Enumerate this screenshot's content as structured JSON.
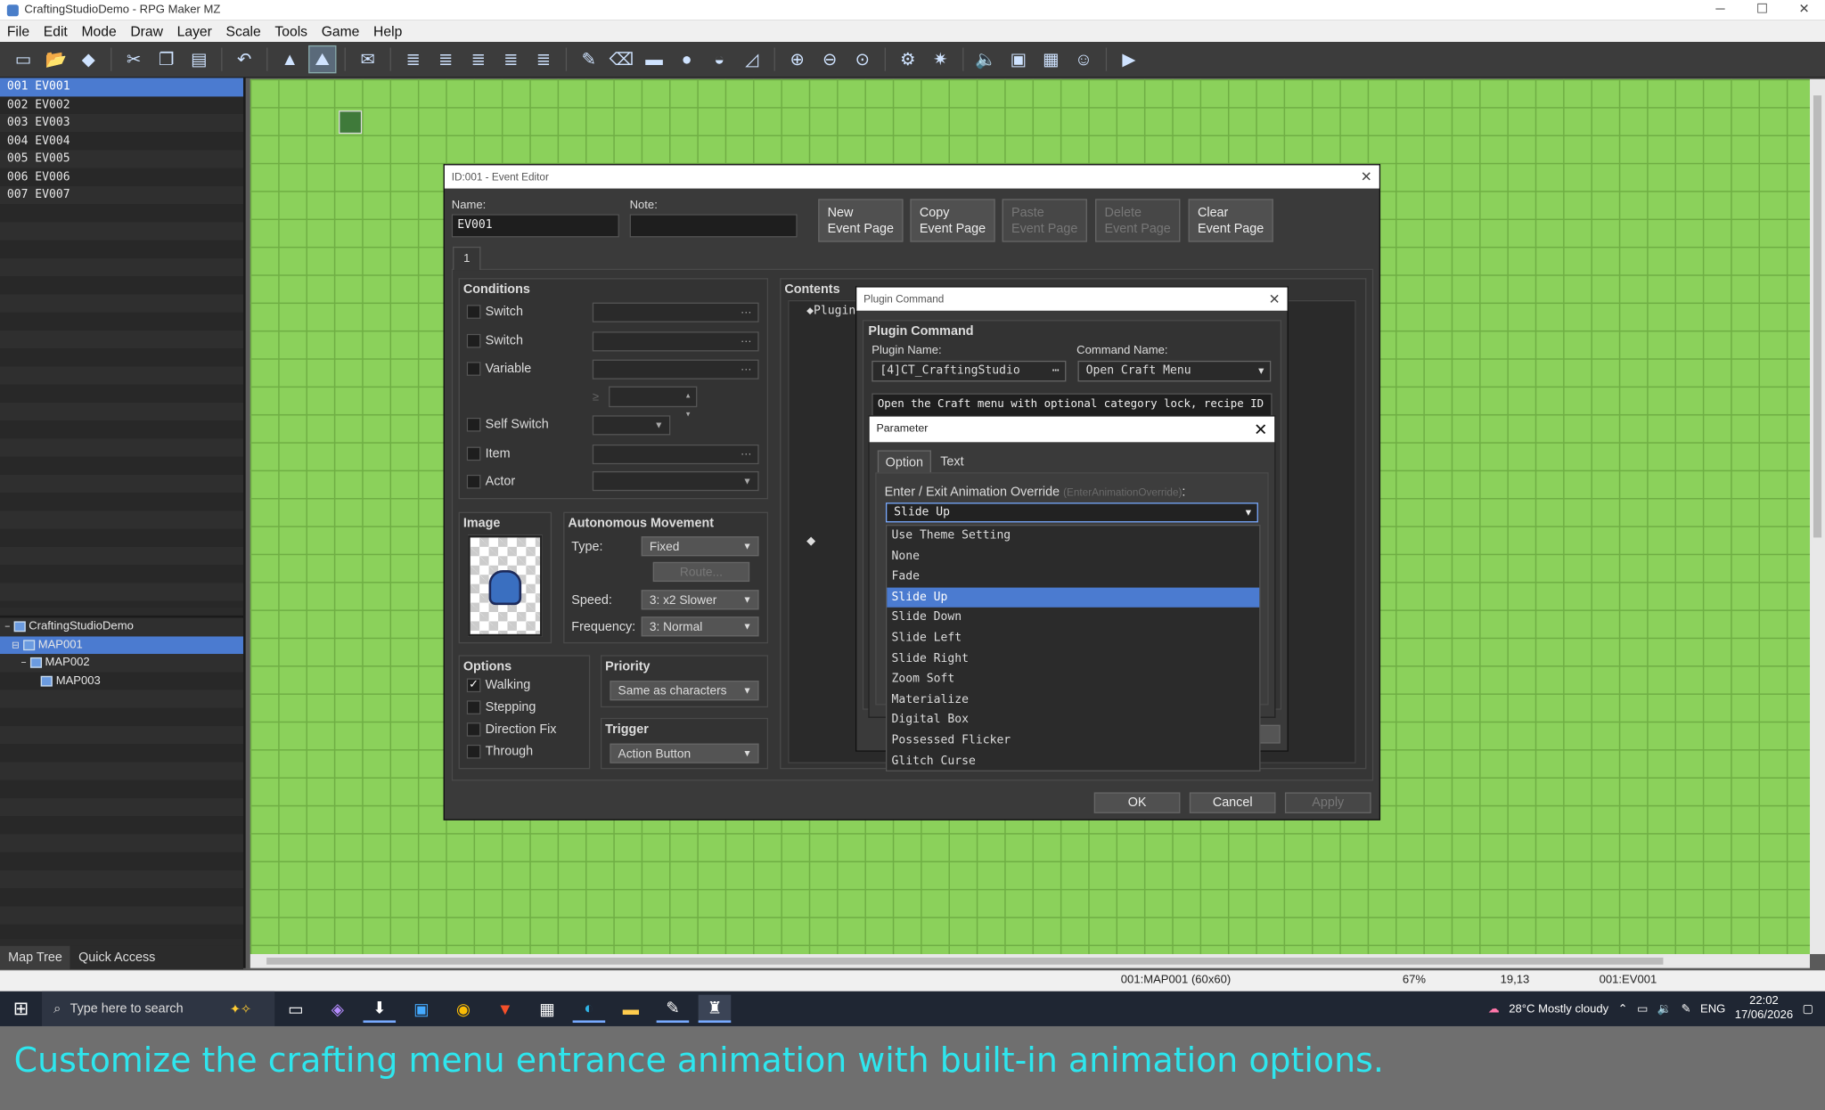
{
  "window": {
    "title": "CraftingStudioDemo - RPG Maker MZ",
    "controls": [
      "─",
      "☐",
      "✕"
    ]
  },
  "menu": [
    "File",
    "Edit",
    "Mode",
    "Draw",
    "Layer",
    "Scale",
    "Tools",
    "Game",
    "Help"
  ],
  "toolbar_icons": [
    "new-icon",
    "open-icon",
    "save-icon",
    "cut-icon",
    "copy-icon",
    "paste-icon",
    "undo-icon",
    "map-mode-icon",
    "event-mode-icon",
    "region-icon",
    "layer1-icon",
    "layer2-icon",
    "layer3-icon",
    "layer4-icon",
    "layer-all-icon",
    "pencil-icon",
    "eraser-icon",
    "rectangle-icon",
    "ellipse-icon",
    "flood-fill-icon",
    "shadow-pen-icon",
    "zoom-in-icon",
    "zoom-out-icon",
    "zoom-actual-icon",
    "database-icon",
    "plugin-manager-icon",
    "sound-test-icon",
    "event-searcher-icon",
    "resource-manager-icon",
    "character-generator-icon",
    "playtest-icon"
  ],
  "events": [
    "001  EV001",
    "002  EV002",
    "003  EV003",
    "004  EV004",
    "005  EV005",
    "006  EV006",
    "007  EV007"
  ],
  "maptree": {
    "root": "CraftingStudioDemo",
    "maps": [
      "MAP001",
      "MAP002",
      "MAP003"
    ]
  },
  "left_tabs": [
    "Map Tree",
    "Quick Access"
  ],
  "event_editor": {
    "title": "ID:001 - Event Editor",
    "name_label": "Name:",
    "name_value": "EV001",
    "note_label": "Note:",
    "buttons": {
      "new": "New\nEvent Page",
      "copy": "Copy\nEvent Page",
      "paste": "Paste\nEvent Page",
      "delete": "Delete\nEvent Page",
      "clear": "Clear\nEvent Page"
    },
    "page_tab": "1",
    "conditions": {
      "title": "Conditions",
      "items": [
        "Switch",
        "Switch",
        "Variable",
        "Self Switch",
        "Item",
        "Actor"
      ],
      "ge": "≥"
    },
    "image_title": "Image",
    "autonomous": {
      "title": "Autonomous Movement",
      "type_label": "Type:",
      "type_value": "Fixed",
      "route": "Route...",
      "speed_label": "Speed:",
      "speed_value": "3: x2 Slower",
      "freq_label": "Frequency:",
      "freq_value": "3: Normal"
    },
    "options": {
      "title": "Options",
      "items": [
        "Walking",
        "Stepping",
        "Direction Fix",
        "Through"
      ]
    },
    "priority": {
      "title": "Priority",
      "value": "Same as characters"
    },
    "trigger": {
      "title": "Trigger",
      "value": "Action Button"
    },
    "contents_title": "Contents",
    "contents_first": "◆Plugin",
    "ok": "OK",
    "cancel": "Cancel",
    "apply": "Apply"
  },
  "plugin_command": {
    "title": "Plugin Command",
    "header": "Plugin Command",
    "plugin_name_label": "Plugin Name:",
    "plugin_name": "[4]CT_CraftingStudio",
    "command_name_label": "Command Name:",
    "command_name": "Open Craft Menu",
    "description": "Open the Craft menu with optional category lock, recipe ID"
  },
  "parameter": {
    "title": "Parameter",
    "tabs": [
      "Option",
      "Text"
    ],
    "field_label": "Enter / Exit Animation Override",
    "field_key": "(EnterAnimationOverride)",
    "selected": "Slide Up",
    "options": [
      "Use Theme Setting",
      "None",
      "Fade",
      "Slide Up",
      "Slide Down",
      "Slide Left",
      "Slide Right",
      "Zoom Soft",
      "Materialize",
      "Digital Box",
      "Possessed Flicker",
      "Glitch Curse"
    ]
  },
  "status": {
    "map": "001:MAP001 (60x60)",
    "zoom": "67%",
    "coords": "19,13",
    "event": "001:EV001"
  },
  "taskbar": {
    "search": "Type here to search",
    "weather": "28°C  Mostly cloudy",
    "lang": "ENG",
    "time": "22:02",
    "date": "17/06/2026"
  },
  "caption": "Customize the crafting menu entrance animation with built-in animation options."
}
